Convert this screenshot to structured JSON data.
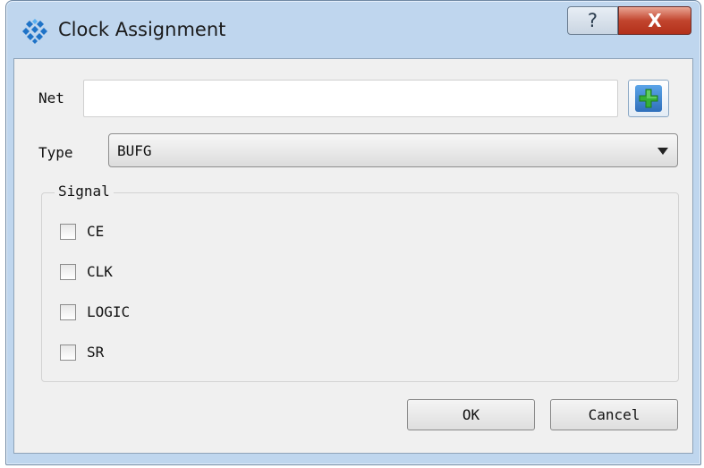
{
  "window": {
    "title": "Clock Assignment",
    "help_label": "?",
    "close_label": "X"
  },
  "form": {
    "net_label": "Net",
    "net_value": "",
    "net_placeholder": "",
    "type_label": "Type",
    "type_value": "BUFG"
  },
  "signal": {
    "title": "Signal",
    "options": [
      {
        "label": "CE",
        "checked": false
      },
      {
        "label": "CLK",
        "checked": false
      },
      {
        "label": "LOGIC",
        "checked": false
      },
      {
        "label": "SR",
        "checked": false
      }
    ]
  },
  "buttons": {
    "ok": "OK",
    "cancel": "Cancel"
  },
  "colors": {
    "titlebar": "#bfd6ee",
    "client_bg": "#f0f0f0",
    "close_red": "#c2452e",
    "add_green": "#35b035",
    "app_icon_blue": "#1f73c7"
  },
  "icons": {
    "app": "diamond-cluster-icon",
    "add": "green-plus-icon",
    "dropdown": "chevron-down-icon"
  }
}
